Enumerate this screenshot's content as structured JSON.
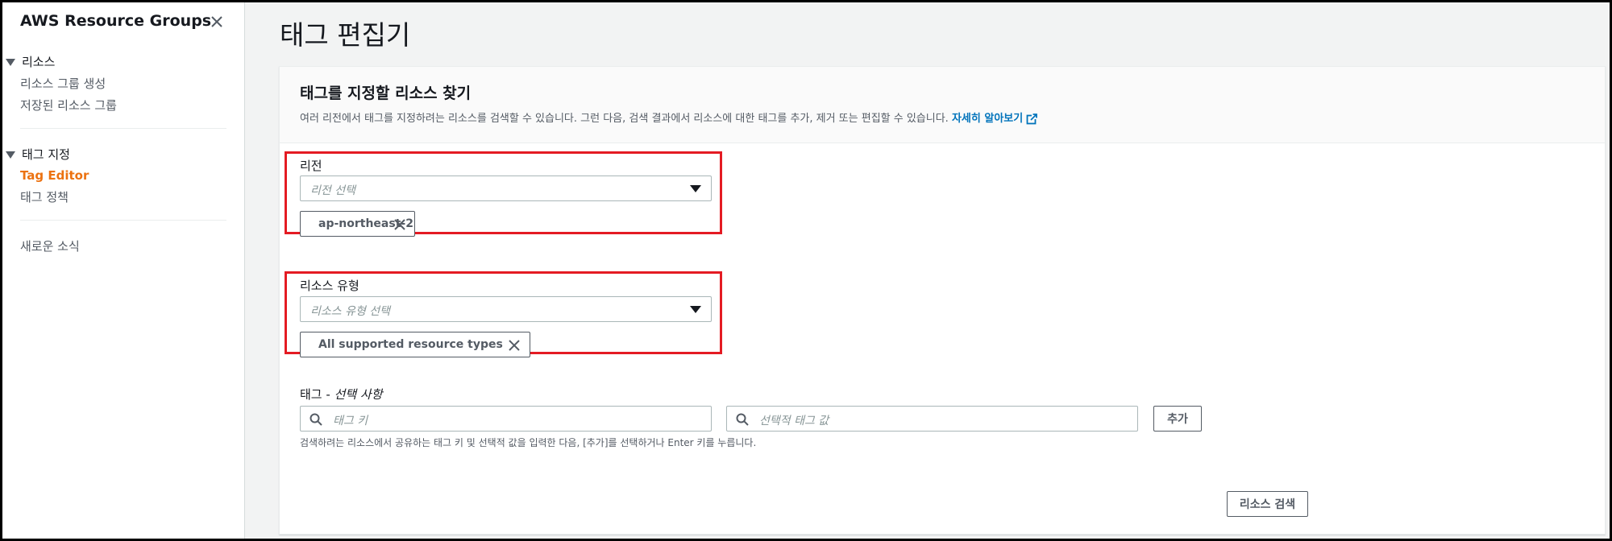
{
  "sidebar": {
    "title": "AWS Resource Groups",
    "sections": [
      {
        "label": "리소스",
        "items": [
          "리소스 그룹 생성",
          "저장된 리소스 그룹"
        ]
      },
      {
        "label": "태그 지정",
        "items": [
          "Tag Editor",
          "태그 정책"
        ],
        "active_item": "Tag Editor"
      }
    ],
    "news": "새로운 소식"
  },
  "page": {
    "title": "태그 편집기"
  },
  "panel": {
    "title": "태그를 지정할 리소스 찾기",
    "description": "여러 리전에서 태그를 지정하려는 리소스를 검색할 수 있습니다. 그런 다음, 검색 결과에서 리소스에 대한 태그를 추가, 제거 또는 편집할 수 있습니다.",
    "learn_more": "자세히 알아보기"
  },
  "region": {
    "label": "리전",
    "placeholder": "리전 선택",
    "selected": "ap-northeast-2"
  },
  "resource_type": {
    "label": "리소스 유형",
    "placeholder": "리소스 유형 선택",
    "selected": "All supported resource types"
  },
  "tags": {
    "label": "태그",
    "label_optional": "선택 사항",
    "key_placeholder": "태그 키",
    "value_placeholder": "선택적 태그 값",
    "add_button": "추가",
    "hint": "검색하려는 리소스에서 공유하는 태그 키 및 선택적 값을 입력한 다음, [추가]를 선택하거나 Enter 키를 누릅니다."
  },
  "search_button": "리소스 검색",
  "colors": {
    "highlight_border": "#e41b23",
    "active_nav": "#ec7211",
    "link": "#0073bb"
  }
}
